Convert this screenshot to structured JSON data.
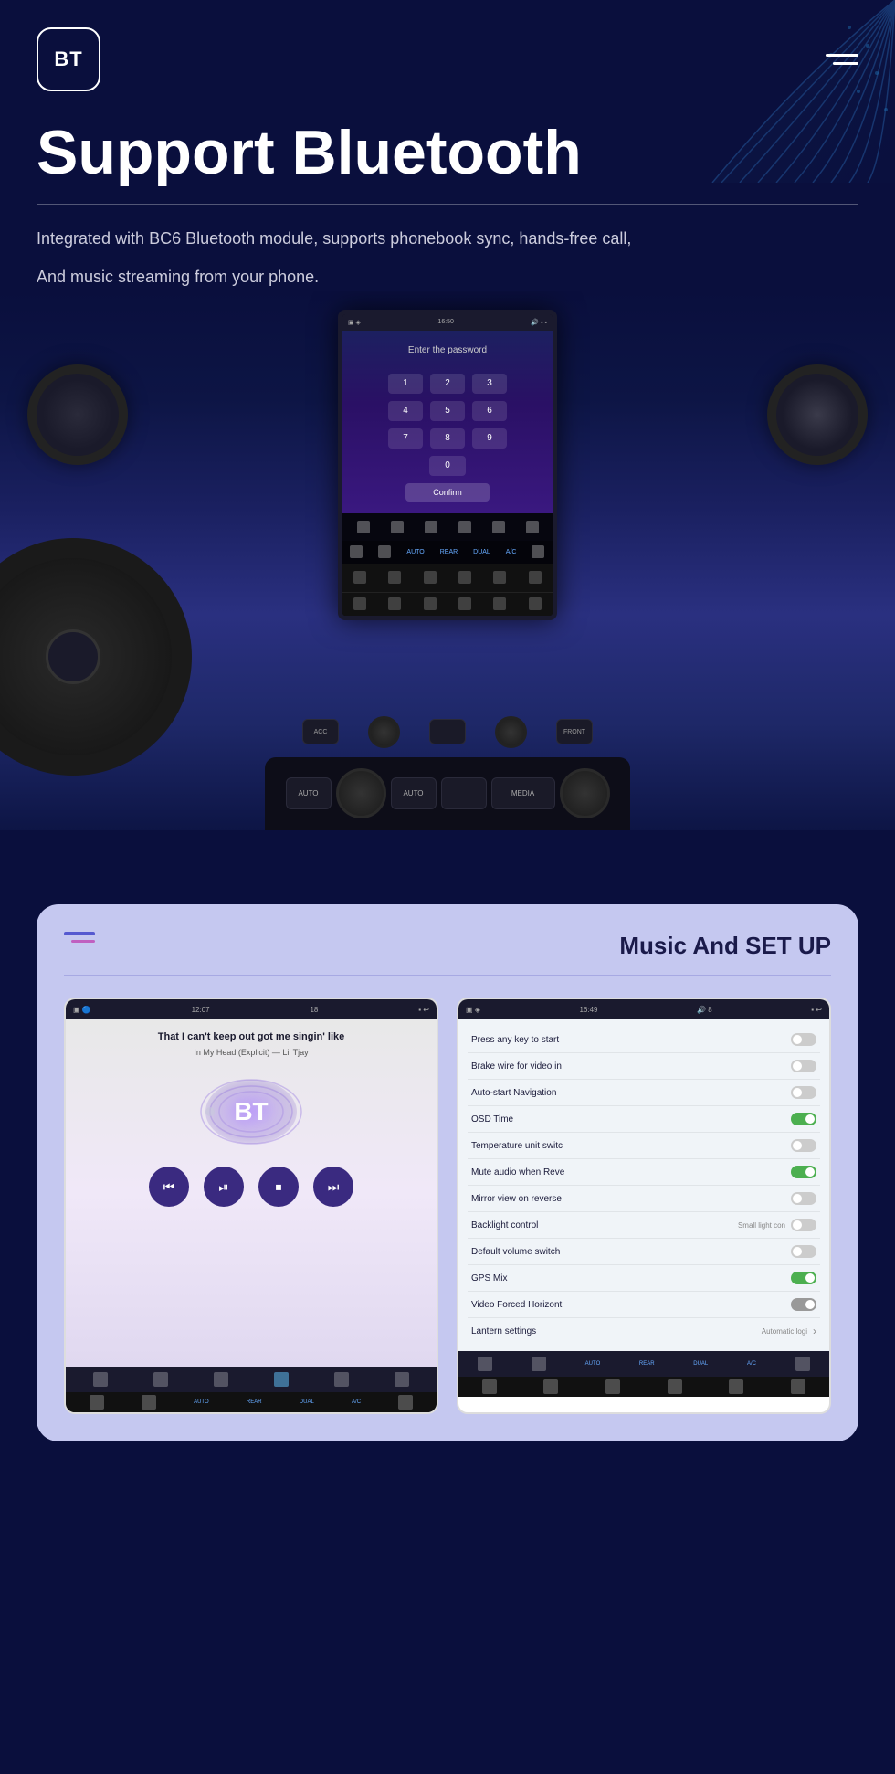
{
  "header": {
    "logo_text": "BT",
    "title": "Support Bluetooth",
    "description_line1": "Integrated with BC6 Bluetooth module, supports phonebook sync, hands-free call,",
    "description_line2": "And music streaming from your phone."
  },
  "car_screen": {
    "time": "16:50",
    "password_prompt": "Enter the password",
    "numpad": [
      "1",
      "2",
      "3",
      "4",
      "5",
      "6",
      "7",
      "8",
      "9",
      "0"
    ],
    "confirm_label": "Confirm"
  },
  "music_section": {
    "section_title": "Music And SET UP",
    "player": {
      "time": "12:07",
      "battery": "18",
      "track_title": "That I can't keep out got me singin' like",
      "track_sub": "In My Head (Explicit) — Lil Tjay",
      "bt_label": "BT"
    },
    "settings": {
      "time": "16:49",
      "battery": "8",
      "rows": [
        {
          "label": "Press any key to start",
          "toggle": "off"
        },
        {
          "label": "Brake wire for video in",
          "toggle": "off"
        },
        {
          "label": "Auto-start Navigation",
          "toggle": "off"
        },
        {
          "label": "OSD Time",
          "toggle": "on"
        },
        {
          "label": "Temperature unit switc",
          "toggle": "off"
        },
        {
          "label": "Mute audio when Reve",
          "toggle": "on"
        },
        {
          "label": "Mirror view on reverse",
          "toggle": "off"
        },
        {
          "label": "Backlight control",
          "note": "Small light con",
          "toggle": "off"
        },
        {
          "label": "Default volume switch",
          "toggle": "off"
        },
        {
          "label": "GPS Mix",
          "toggle": "on"
        },
        {
          "label": "Video Forced Horizont",
          "toggle": "gray"
        },
        {
          "label": "Lantern settings",
          "note": "Automatic logi",
          "arrow": "›"
        }
      ]
    }
  },
  "icons": {
    "hamburger": "≡",
    "rewind": "⏮",
    "play": "⏯",
    "stop": "⏹",
    "forward": "⏭",
    "wifi": "📶",
    "bluetooth": "🔵",
    "settings": "⚙",
    "home": "⌂"
  }
}
